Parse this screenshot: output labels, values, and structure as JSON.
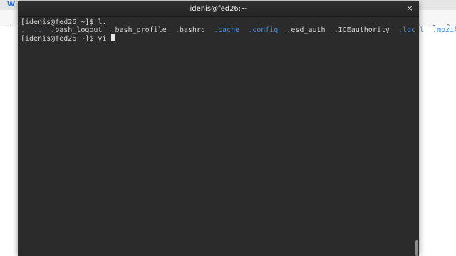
{
  "terminal": {
    "title": "idenis@fed26:~",
    "close_glyph": "×",
    "lines": [
      {
        "prompt": "[idenis@fed26 ~]$ ",
        "command": "l."
      },
      {
        "entries": [
          {
            "name": ".",
            "type": "dir"
          },
          {
            "name": "..",
            "type": "dir"
          },
          {
            "name": ".bash_logout",
            "type": "file"
          },
          {
            "name": ".bash_profile",
            "type": "file"
          },
          {
            "name": ".bashrc",
            "type": "file"
          },
          {
            "name": ".cache",
            "type": "dir"
          },
          {
            "name": ".config",
            "type": "dir"
          },
          {
            "name": ".esd_auth",
            "type": "file"
          },
          {
            "name": ".ICEauthority",
            "type": "file"
          },
          {
            "name": ".local",
            "type": "dir"
          },
          {
            "name": ".mozilla",
            "type": "dir"
          }
        ]
      },
      {
        "prompt": "[idenis@fed26 ~]$ ",
        "command": "vi "
      }
    ],
    "colors": {
      "background": "#2b2b2b",
      "text": "#d3d3d3",
      "directory": "#3d8fe0"
    }
  },
  "background_app": {
    "tab_icon": "W",
    "toolbar_icons": [
      "back-icon",
      "star-icon",
      "home-icon",
      "shield-icon"
    ]
  }
}
